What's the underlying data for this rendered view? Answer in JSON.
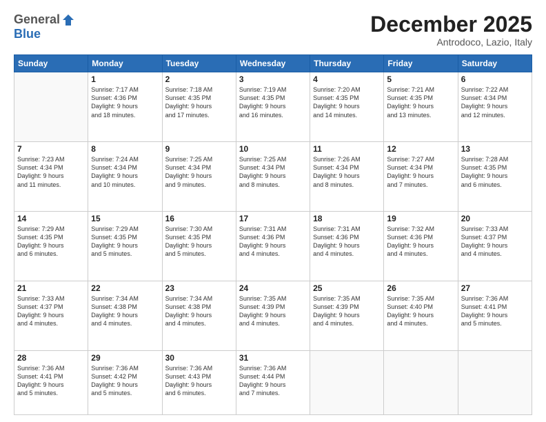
{
  "logo": {
    "general": "General",
    "blue": "Blue"
  },
  "header": {
    "month_title": "December 2025",
    "location": "Antrodoco, Lazio, Italy"
  },
  "days_of_week": [
    "Sunday",
    "Monday",
    "Tuesday",
    "Wednesday",
    "Thursday",
    "Friday",
    "Saturday"
  ],
  "weeks": [
    [
      {
        "day": "",
        "info": ""
      },
      {
        "day": "1",
        "info": "Sunrise: 7:17 AM\nSunset: 4:36 PM\nDaylight: 9 hours\nand 18 minutes."
      },
      {
        "day": "2",
        "info": "Sunrise: 7:18 AM\nSunset: 4:35 PM\nDaylight: 9 hours\nand 17 minutes."
      },
      {
        "day": "3",
        "info": "Sunrise: 7:19 AM\nSunset: 4:35 PM\nDaylight: 9 hours\nand 16 minutes."
      },
      {
        "day": "4",
        "info": "Sunrise: 7:20 AM\nSunset: 4:35 PM\nDaylight: 9 hours\nand 14 minutes."
      },
      {
        "day": "5",
        "info": "Sunrise: 7:21 AM\nSunset: 4:35 PM\nDaylight: 9 hours\nand 13 minutes."
      },
      {
        "day": "6",
        "info": "Sunrise: 7:22 AM\nSunset: 4:34 PM\nDaylight: 9 hours\nand 12 minutes."
      }
    ],
    [
      {
        "day": "7",
        "info": "Sunrise: 7:23 AM\nSunset: 4:34 PM\nDaylight: 9 hours\nand 11 minutes."
      },
      {
        "day": "8",
        "info": "Sunrise: 7:24 AM\nSunset: 4:34 PM\nDaylight: 9 hours\nand 10 minutes."
      },
      {
        "day": "9",
        "info": "Sunrise: 7:25 AM\nSunset: 4:34 PM\nDaylight: 9 hours\nand 9 minutes."
      },
      {
        "day": "10",
        "info": "Sunrise: 7:25 AM\nSunset: 4:34 PM\nDaylight: 9 hours\nand 8 minutes."
      },
      {
        "day": "11",
        "info": "Sunrise: 7:26 AM\nSunset: 4:34 PM\nDaylight: 9 hours\nand 8 minutes."
      },
      {
        "day": "12",
        "info": "Sunrise: 7:27 AM\nSunset: 4:34 PM\nDaylight: 9 hours\nand 7 minutes."
      },
      {
        "day": "13",
        "info": "Sunrise: 7:28 AM\nSunset: 4:35 PM\nDaylight: 9 hours\nand 6 minutes."
      }
    ],
    [
      {
        "day": "14",
        "info": "Sunrise: 7:29 AM\nSunset: 4:35 PM\nDaylight: 9 hours\nand 6 minutes."
      },
      {
        "day": "15",
        "info": "Sunrise: 7:29 AM\nSunset: 4:35 PM\nDaylight: 9 hours\nand 5 minutes."
      },
      {
        "day": "16",
        "info": "Sunrise: 7:30 AM\nSunset: 4:35 PM\nDaylight: 9 hours\nand 5 minutes."
      },
      {
        "day": "17",
        "info": "Sunrise: 7:31 AM\nSunset: 4:36 PM\nDaylight: 9 hours\nand 4 minutes."
      },
      {
        "day": "18",
        "info": "Sunrise: 7:31 AM\nSunset: 4:36 PM\nDaylight: 9 hours\nand 4 minutes."
      },
      {
        "day": "19",
        "info": "Sunrise: 7:32 AM\nSunset: 4:36 PM\nDaylight: 9 hours\nand 4 minutes."
      },
      {
        "day": "20",
        "info": "Sunrise: 7:33 AM\nSunset: 4:37 PM\nDaylight: 9 hours\nand 4 minutes."
      }
    ],
    [
      {
        "day": "21",
        "info": "Sunrise: 7:33 AM\nSunset: 4:37 PM\nDaylight: 9 hours\nand 4 minutes."
      },
      {
        "day": "22",
        "info": "Sunrise: 7:34 AM\nSunset: 4:38 PM\nDaylight: 9 hours\nand 4 minutes."
      },
      {
        "day": "23",
        "info": "Sunrise: 7:34 AM\nSunset: 4:38 PM\nDaylight: 9 hours\nand 4 minutes."
      },
      {
        "day": "24",
        "info": "Sunrise: 7:35 AM\nSunset: 4:39 PM\nDaylight: 9 hours\nand 4 minutes."
      },
      {
        "day": "25",
        "info": "Sunrise: 7:35 AM\nSunset: 4:39 PM\nDaylight: 9 hours\nand 4 minutes."
      },
      {
        "day": "26",
        "info": "Sunrise: 7:35 AM\nSunset: 4:40 PM\nDaylight: 9 hours\nand 4 minutes."
      },
      {
        "day": "27",
        "info": "Sunrise: 7:36 AM\nSunset: 4:41 PM\nDaylight: 9 hours\nand 5 minutes."
      }
    ],
    [
      {
        "day": "28",
        "info": "Sunrise: 7:36 AM\nSunset: 4:41 PM\nDaylight: 9 hours\nand 5 minutes."
      },
      {
        "day": "29",
        "info": "Sunrise: 7:36 AM\nSunset: 4:42 PM\nDaylight: 9 hours\nand 5 minutes."
      },
      {
        "day": "30",
        "info": "Sunrise: 7:36 AM\nSunset: 4:43 PM\nDaylight: 9 hours\nand 6 minutes."
      },
      {
        "day": "31",
        "info": "Sunrise: 7:36 AM\nSunset: 4:44 PM\nDaylight: 9 hours\nand 7 minutes."
      },
      {
        "day": "",
        "info": ""
      },
      {
        "day": "",
        "info": ""
      },
      {
        "day": "",
        "info": ""
      }
    ]
  ]
}
